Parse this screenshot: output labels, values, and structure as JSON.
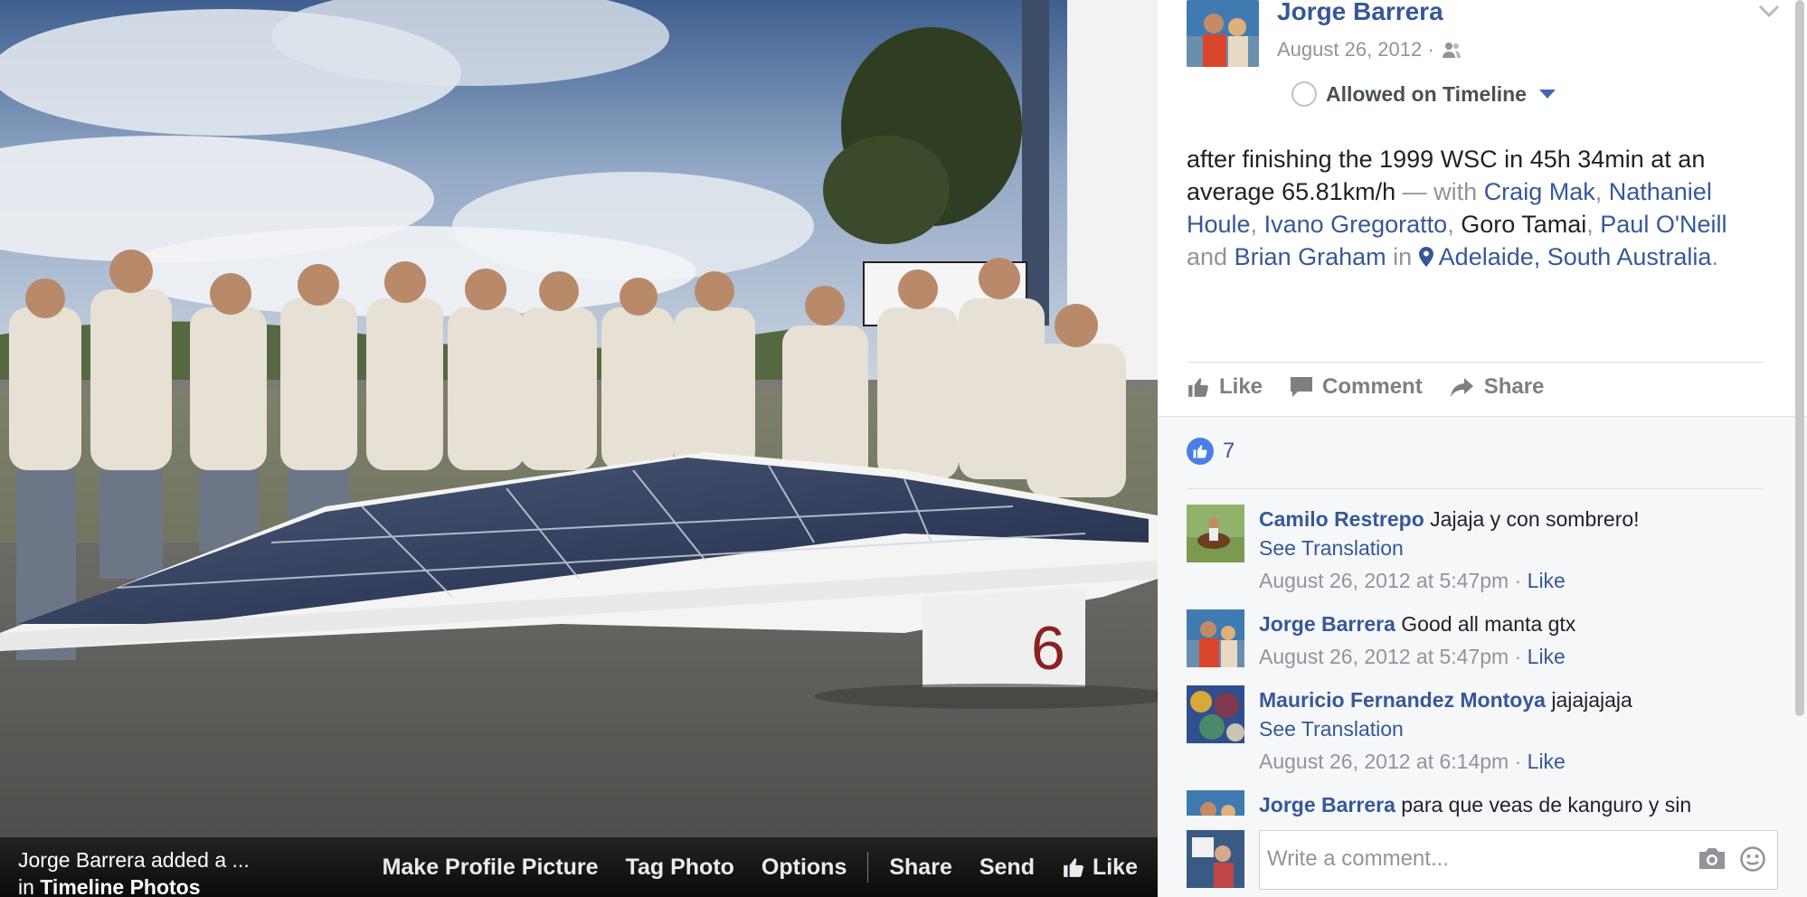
{
  "photo_bar": {
    "title_line1": "Jorge Barrera added a ...",
    "title_line2_prefix": "in ",
    "title_line2_album": "Timeline Photos",
    "actions": {
      "make_profile": "Make Profile Picture",
      "tag_photo": "Tag Photo",
      "options": "Options",
      "share": "Share",
      "send": "Send",
      "like": "Like"
    }
  },
  "post": {
    "author": "Jorge Barrera",
    "date": "August 26, 2012 ·",
    "privacy_icon": "friends-icon",
    "timeline_status": "Allowed on Timeline",
    "caption": {
      "text": "after finishing the 1999 WSC in 45h 34min at an average 65.81km/h",
      "with": " — with ",
      "tag1": "Craig Mak",
      "sep1": ", ",
      "tag2": "Nathaniel Houle",
      "sep2": ", ",
      "tag3": "Ivano Gregoratto",
      "sep3": ", ",
      "plain": "Goro Tamai",
      "sep4": ", ",
      "tag4": "Paul O'Neill",
      "and": " and ",
      "tag5": "Brian Graham",
      "in": " in ",
      "place": "Adelaide, South Australia",
      "end": "."
    },
    "actions": {
      "like": "Like",
      "comment": "Comment",
      "share": "Share"
    },
    "like_count": "7"
  },
  "comments": [
    {
      "name": "Camilo Restrepo",
      "text": "Jajaja y con sombrero!",
      "translate": "See Translation",
      "time": "August 26, 2012 at 5:47pm",
      "like": "Like"
    },
    {
      "name": "Jorge Barrera",
      "text": "Good all manta gtx",
      "translate": "",
      "time": "August 26, 2012 at 5:47pm",
      "like": "Like"
    },
    {
      "name": "Mauricio Fernandez Montoya",
      "text": "jajajajaja",
      "translate": "See Translation",
      "time": "August 26, 2012 at 6:14pm",
      "like": "Like"
    },
    {
      "name": "Jorge Barrera",
      "text": "para que veas de kanguro y sin",
      "translate": "",
      "time": "",
      "like": ""
    }
  ],
  "composer": {
    "placeholder": "Write a comment..."
  },
  "colors": {
    "link": "#365899",
    "muted": "#90949c",
    "like_blue": "#4a7ee5"
  }
}
